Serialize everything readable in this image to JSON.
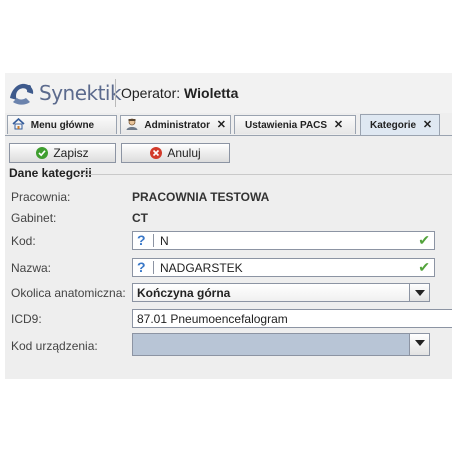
{
  "header": {
    "brand": "Synektik",
    "operator_label": "Operator:",
    "operator_name": "Wioletta"
  },
  "tabs": [
    {
      "label": "Menu główne",
      "icon": "home-icon",
      "closable": false
    },
    {
      "label": "Administrator",
      "icon": "user-icon",
      "closable": true
    },
    {
      "label": "Ustawienia PACS",
      "closable": true
    },
    {
      "label": "Kategorie",
      "closable": true,
      "active": true
    }
  ],
  "close_glyph": "✕",
  "toolbar": {
    "save_label": "Zapisz",
    "cancel_label": "Anuluj"
  },
  "section": {
    "title": "Dane kategorii"
  },
  "form": {
    "pracownia": {
      "label": "Pracownia:",
      "value": "PRACOWNIA TESTOWA"
    },
    "gabinet": {
      "label": "Gabinet:",
      "value": "CT"
    },
    "kod": {
      "label": "Kod:",
      "value": "N",
      "hint": "?",
      "valid": true
    },
    "nazwa": {
      "label": "Nazwa:",
      "value": "NADGARSTEK",
      "hint": "?",
      "valid": true
    },
    "okolica": {
      "label": "Okolica anatomiczna:",
      "value": "Kończyna górna"
    },
    "icd9": {
      "label": "ICD9:",
      "value": "87.01 Pneumoencefalogram"
    },
    "kod_urzadzenia": {
      "label": "Kod urządzenia:",
      "value": ""
    }
  },
  "colors": {
    "accent": "#3a78c8",
    "valid": "#52a33b",
    "save_icon": "#3f9e2f",
    "cancel_icon": "#d23a2a",
    "disabled_field": "#b8c5d6"
  }
}
